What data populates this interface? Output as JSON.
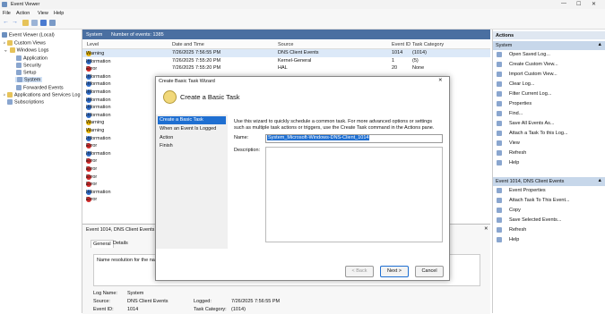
{
  "app_title": "Event Viewer",
  "menu": [
    "File",
    "Action",
    "View",
    "Help"
  ],
  "tree": [
    {
      "label": "Event Viewer (Local)",
      "indent": 0
    },
    {
      "label": "Custom Views",
      "indent": 1
    },
    {
      "label": "Windows Logs",
      "indent": 1
    },
    {
      "label": "Application",
      "indent": 2
    },
    {
      "label": "Security",
      "indent": 2
    },
    {
      "label": "Setup",
      "indent": 2
    },
    {
      "label": "System",
      "indent": 2
    },
    {
      "label": "Forwarded Events",
      "indent": 2
    },
    {
      "label": "Applications and Services Log",
      "indent": 1
    },
    {
      "label": "Subscriptions",
      "indent": 1
    }
  ],
  "log_header": {
    "name": "System",
    "count": "Number of events: 1385"
  },
  "columns": [
    "Level",
    "Date and Time",
    "Source",
    "Event ID",
    "Task Category"
  ],
  "events": [
    {
      "level": "Warning",
      "date": "7/26/2025 7:56:55 PM",
      "source": "DNS Client Events",
      "id": "1014",
      "task": "(1014)"
    },
    {
      "level": "Information",
      "date": "7/26/2025 7:55:20 PM",
      "source": "Kernel-General",
      "id": "1",
      "task": "(5)"
    },
    {
      "level": "Error",
      "date": "7/26/2025 7:55:20 PM",
      "source": "HAL",
      "id": "20",
      "task": "None"
    },
    {
      "level": "Information",
      "date": "",
      "source": "",
      "id": "",
      "task": ""
    },
    {
      "level": "Information",
      "date": "",
      "source": "",
      "id": "",
      "task": ""
    },
    {
      "level": "Information",
      "date": "",
      "source": "",
      "id": "",
      "task": ""
    },
    {
      "level": "Information",
      "date": "",
      "source": "",
      "id": "",
      "task": ""
    },
    {
      "level": "Information",
      "date": "",
      "source": "",
      "id": "",
      "task": ""
    },
    {
      "level": "Information",
      "date": "",
      "source": "",
      "id": "",
      "task": ""
    },
    {
      "level": "Warning",
      "date": "",
      "source": "",
      "id": "",
      "task": ""
    },
    {
      "level": "Warning",
      "date": "",
      "source": "",
      "id": "",
      "task": ""
    },
    {
      "level": "Information",
      "date": "",
      "source": "",
      "id": "",
      "task": ""
    },
    {
      "level": "Error",
      "date": "",
      "source": "",
      "id": "",
      "task": ""
    },
    {
      "level": "Information",
      "date": "",
      "source": "",
      "id": "",
      "task": ""
    },
    {
      "level": "Error",
      "date": "",
      "source": "",
      "id": "",
      "task": ""
    },
    {
      "level": "Error",
      "date": "",
      "source": "",
      "id": "",
      "task": ""
    },
    {
      "level": "Error",
      "date": "",
      "source": "",
      "id": "",
      "task": ""
    },
    {
      "level": "Error",
      "date": "",
      "source": "",
      "id": "",
      "task": ""
    },
    {
      "level": "Information",
      "date": "",
      "source": "",
      "id": "",
      "task": ""
    },
    {
      "level": "Error",
      "date": "",
      "source": "",
      "id": "",
      "task": ""
    }
  ],
  "detail": {
    "header": "Event 1014, DNS Client Events",
    "tabs": [
      "General",
      "Details"
    ],
    "message": "Name resolution for the na",
    "log_name_label": "Log Name:",
    "log_name": "System",
    "source_label": "Source:",
    "source": "DNS Client Events",
    "logged_label": "Logged:",
    "logged": "7/26/2025 7:56:55 PM",
    "event_id_label": "Event ID:",
    "event_id": "1014",
    "task_label": "Task Category:",
    "task": "(1014)"
  },
  "actions": {
    "title": "Actions",
    "section1": "System",
    "items1": [
      "Open Saved Log...",
      "Create Custom View...",
      "Import Custom View...",
      "Clear Log...",
      "Filter Current Log...",
      "Properties",
      "Find...",
      "Save All Events As...",
      "Attach a Task To this Log...",
      "View",
      "Refresh",
      "Help"
    ],
    "section2": "Event 1014, DNS Client Events",
    "items2": [
      "Event Properties",
      "Attach Task To This Event...",
      "Copy",
      "Save Selected Events...",
      "Refresh",
      "Help"
    ]
  },
  "dialog": {
    "title": "Create Basic Task Wizard",
    "heading": "Create a Basic Task",
    "steps": [
      "Create a Basic Task",
      "When an Event Is Logged",
      "Action",
      "Finish"
    ],
    "intro": "Use this wizard to quickly schedule a common task. For more advanced options or settings such as multiple task actions or triggers, use the Create Task command in the Actions pane.",
    "name_label": "Name:",
    "name_value": "System_Microsoft-Windows-DNS-Client_1014",
    "desc_label": "Description:",
    "back": "< Back",
    "next": "Next >",
    "cancel": "Cancel"
  },
  "colors": {
    "accent": "#1f6fd1",
    "header": "#4a6fa1",
    "warning": "#e8b400",
    "error": "#d42a2a",
    "info": "#2f6fce"
  }
}
